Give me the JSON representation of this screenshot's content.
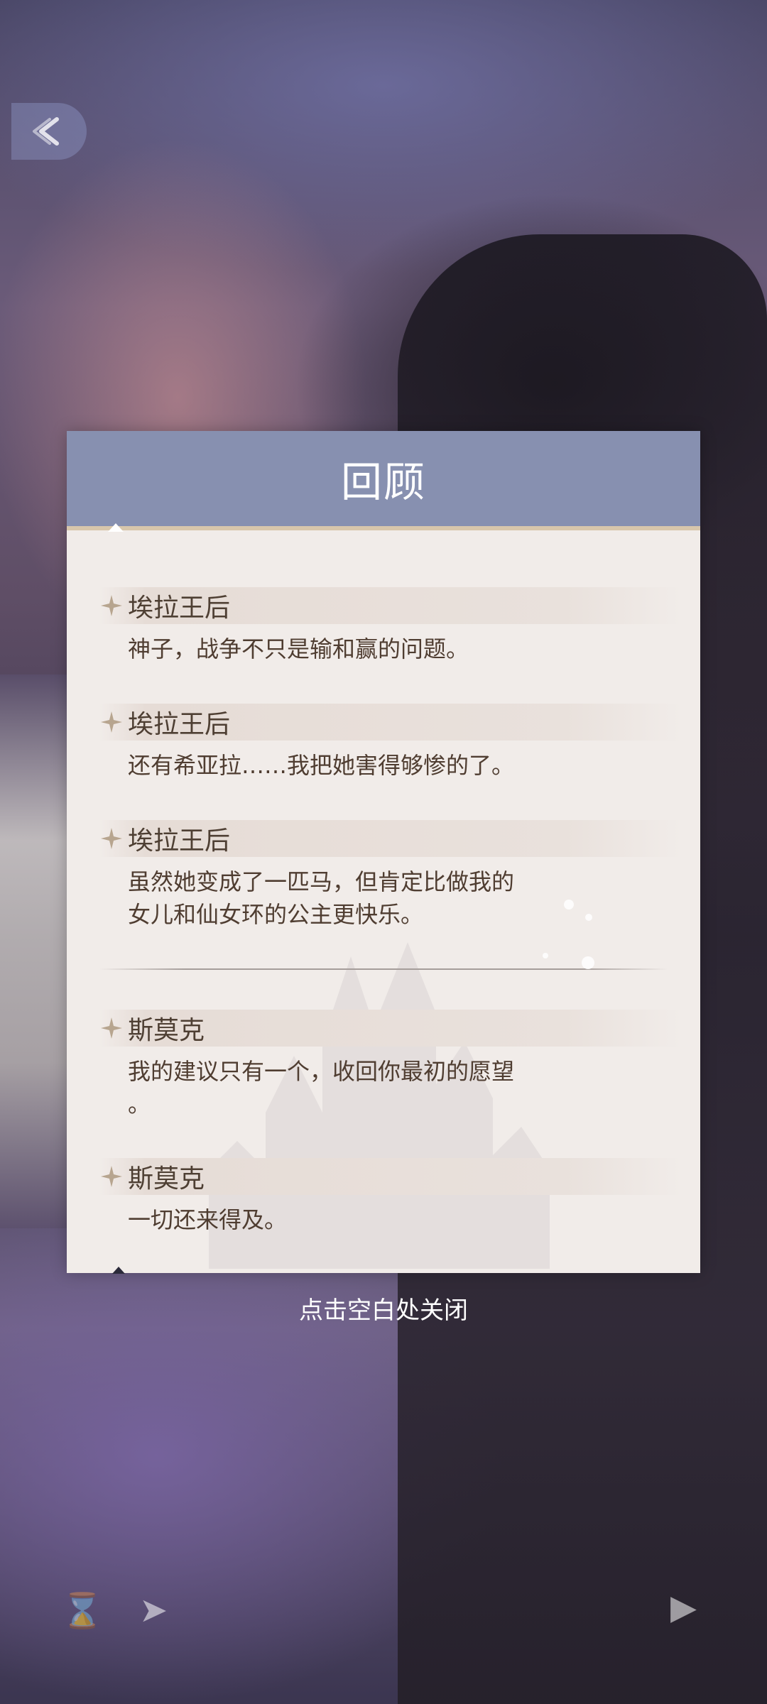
{
  "dialog": {
    "title": "回顾",
    "entries": [
      {
        "speaker": "埃拉王后",
        "text": "神子，战争不只是输和赢的问题。"
      },
      {
        "speaker": "埃拉王后",
        "text": "还有希亚拉……我把她害得够惨的了。"
      },
      {
        "speaker": "埃拉王后",
        "text": "虽然她变成了一匹马，但肯定比做我的\n女儿和仙女环的公主更快乐。"
      },
      {
        "speaker": "斯莫克",
        "text": "我的建议只有一个，收回你最初的愿望\n。"
      },
      {
        "speaker": "斯莫克",
        "text": "一切还来得及。"
      }
    ]
  },
  "close_hint": "点击空白处关闭",
  "icons": {
    "back": "back-arrow-icon",
    "speaker_marker": "star-icon",
    "skip": "hourglass-icon",
    "auto": "play-icon"
  },
  "colors": {
    "header": "#8790b0",
    "panel": "#f1ece9",
    "text": "#4f3d31",
    "accent_line": "#d8c6ab"
  }
}
